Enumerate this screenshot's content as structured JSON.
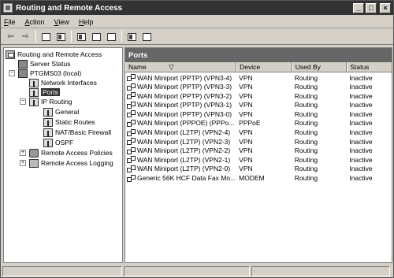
{
  "window": {
    "title": "Routing and Remote Access"
  },
  "title_buttons": {
    "minimize": "_",
    "maximize": "□",
    "close": "×"
  },
  "menu": {
    "file": {
      "accel": "F",
      "rest": "ile"
    },
    "action": {
      "accel": "A",
      "rest": "ction"
    },
    "view": {
      "accel": "V",
      "rest": "iew"
    },
    "help": {
      "accel": "H",
      "rest": "elp"
    }
  },
  "toolbar": {
    "back_glyph": "⇦",
    "forward_glyph": "⇨",
    "icons": [
      "back-icon",
      "forward-icon",
      "up-level-icon",
      "show-hide-tree-icon",
      "properties-icon",
      "export-list-icon",
      "refresh-icon",
      "help-icon",
      "show-hide-action-pane-icon"
    ]
  },
  "tree": {
    "root": "Routing and Remote Access",
    "server_status": "Server Status",
    "server": "PTGMS03 (local)",
    "network_interfaces": "Network Interfaces",
    "ports": "Ports",
    "ip_routing": "IP Routing",
    "general": "General",
    "static_routes": "Static Routes",
    "nat": "NAT/Basic Firewall",
    "ospf": "OSPF",
    "remote_access_policies": "Remote Access Policies",
    "remote_access_logging": "Remote Access Logging",
    "expand_minus": "−",
    "expand_plus": "+"
  },
  "right_pane": {
    "header": "Ports",
    "columns": {
      "name": "Name",
      "device": "Device",
      "used_by": "Used By",
      "status": "Status",
      "sort_glyph": "▽"
    },
    "rows": [
      {
        "name": "WAN Miniport (PPTP) (VPN3-4)",
        "device": "VPN",
        "used_by": "Routing",
        "status": "Inactive"
      },
      {
        "name": "WAN Miniport (PPTP) (VPN3-3)",
        "device": "VPN",
        "used_by": "Routing",
        "status": "Inactive"
      },
      {
        "name": "WAN Miniport (PPTP) (VPN3-2)",
        "device": "VPN",
        "used_by": "Routing",
        "status": "Inactive"
      },
      {
        "name": "WAN Miniport (PPTP) (VPN3-1)",
        "device": "VPN",
        "used_by": "Routing",
        "status": "Inactive"
      },
      {
        "name": "WAN Miniport (PPTP) (VPN3-0)",
        "device": "VPN",
        "used_by": "Routing",
        "status": "Inactive"
      },
      {
        "name": "WAN Miniport (PPPOE) (PPPo...",
        "device": "PPPoE",
        "used_by": "Routing",
        "status": "Inactive"
      },
      {
        "name": "WAN Miniport (L2TP) (VPN2-4)",
        "device": "VPN",
        "used_by": "Routing",
        "status": "Inactive"
      },
      {
        "name": "WAN Miniport (L2TP) (VPN2-3)",
        "device": "VPN",
        "used_by": "Routing",
        "status": "Inactive"
      },
      {
        "name": "WAN Miniport (L2TP) (VPN2-2)",
        "device": "VPN",
        "used_by": "Routing",
        "status": "Inactive"
      },
      {
        "name": "WAN Miniport (L2TP) (VPN2-1)",
        "device": "VPN",
        "used_by": "Routing",
        "status": "Inactive"
      },
      {
        "name": "WAN Miniport (L2TP) (VPN2-0)",
        "device": "VPN",
        "used_by": "Routing",
        "status": "Inactive"
      },
      {
        "name": "Generic 56K HCF Data Fax Mo...",
        "device": "MODEM",
        "used_by": "Routing",
        "status": "Inactive"
      }
    ]
  }
}
